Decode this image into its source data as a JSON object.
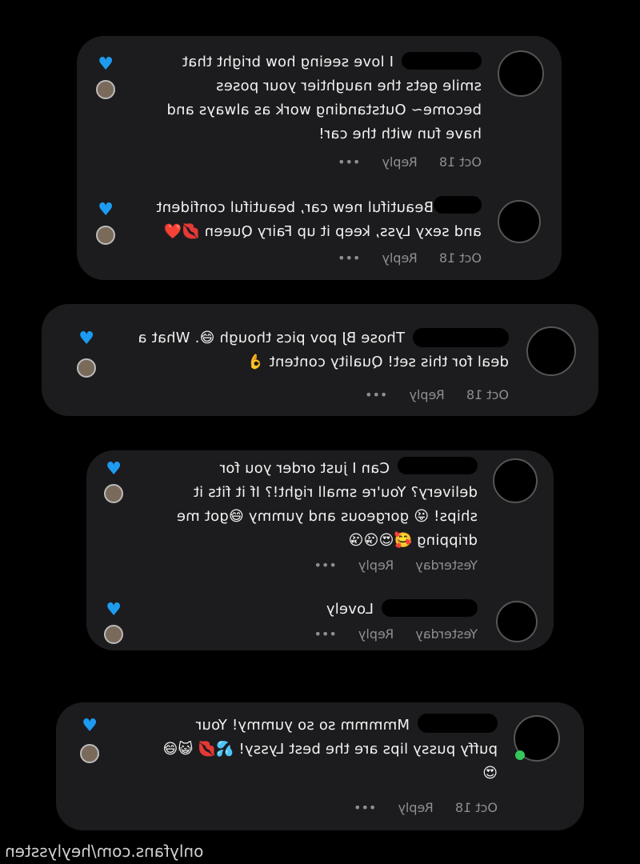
{
  "comments": [
    {
      "name_fragment": "",
      "text": "I love seeing how bright that smile gets the naughtier your poses become~ Outstanding work as always and have fun with the car!",
      "date": "Oct 18",
      "reply": "Reply",
      "more": "•••"
    },
    {
      "name_fragment": "",
      "text": "Beautiful new car, beautiful confident and sexy Lyss, keep it up Fairy Queen 💋❤️",
      "date": "Oct 18",
      "reply": "Reply",
      "more": "•••"
    },
    {
      "name_fragment": "",
      "text": "Those BJ pov pics though 😅. What a deal for this set! Quality content 👌",
      "date": "Oct 18",
      "reply": "Reply",
      "more": "•••"
    },
    {
      "name_fragment": "",
      "text": "Can I just order you for delivery? You're small right!? If it fits it ships! 😜 gorgeous and yummy 😅got me dripping 🥰😍😘😘",
      "date": "Yesterday",
      "reply": "Reply",
      "more": "•••"
    },
    {
      "name_fragment": "",
      "text": "Lovely",
      "date": "Yesterday",
      "reply": "Reply",
      "more": "•••"
    },
    {
      "name_fragment": "",
      "text": "Mmmmm so so yummy! Your puffy pussy lips are the best Lyssy! 💦💋 😺😅😍",
      "date": "Oct 18",
      "reply": "Reply",
      "more": "•••"
    }
  ],
  "watermark": "onlyfans.com/heylyssten",
  "colors": {
    "card": "#1c1c1e",
    "heart": "#1d9bf0",
    "meta": "#8e8e93",
    "online": "#34c759"
  },
  "icons": {
    "like": "heart-icon",
    "creator_like": "creator-avatar-icon",
    "more": "more-icon"
  }
}
